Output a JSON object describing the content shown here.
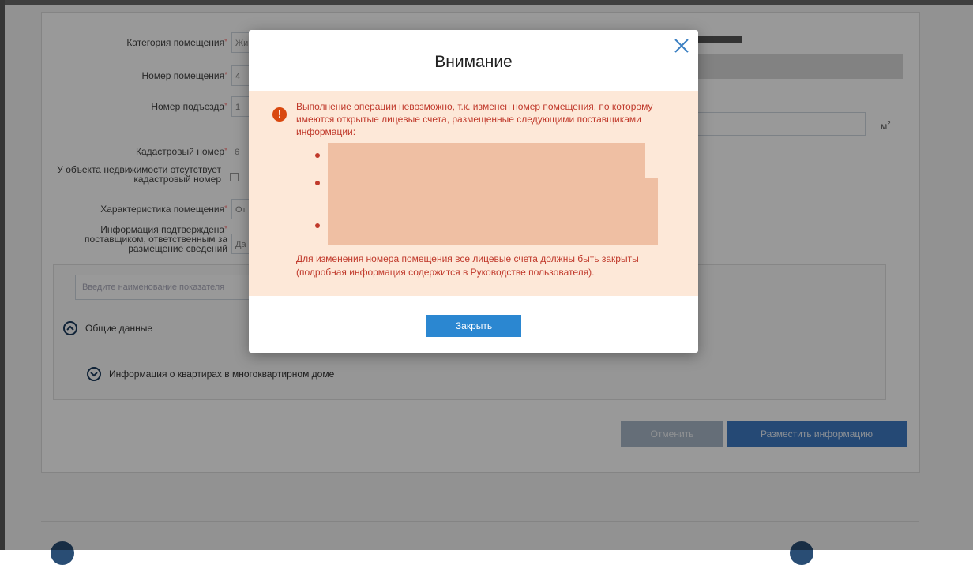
{
  "form": {
    "labels": {
      "category": "Категория помещения",
      "room_number": "Номер помещения",
      "entrance_number": "Номер подъезда",
      "cadastral_number": "Кадастровый номер",
      "no_cadastral_line1": "У объекта недвижимости отсутствует",
      "no_cadastral_line2": "кадастровый номер",
      "characteristic": "Характеристика помещения",
      "confirmed_line1": "Информация подтверждена",
      "confirmed_line2": "поставщиком, ответственным за",
      "confirmed_line3": "размещение сведений"
    },
    "required_mark": "*",
    "values": {
      "category": "Жи",
      "room_number": "4",
      "entrance_number": "1",
      "cadastral_number": "6",
      "characteristic": "От",
      "confirmed": "Да"
    },
    "area_unit": "м",
    "area_unit_sup": "2",
    "search_placeholder": "Введите наименование показателя",
    "section_general": "Общие данные",
    "section_apartments": "Информация о квартирах в многоквартирном доме",
    "cancel_label": "Отменить",
    "submit_label": "Разместить информацию"
  },
  "modal": {
    "title": "Внимание",
    "close_icon": "close-icon",
    "alert_icon": "exclamation-icon",
    "message": "Выполнение операции невозможно, т.к. изменен номер помещения, по которому имеются открытые лицевые счета, размещенные следующими поставщиками информации:",
    "footer_message": "Для изменения номера помещения все лицевые счета должны быть закрыты (подробная информация содержится в Руководстве пользователя).",
    "close_button_label": "Закрыть"
  },
  "colors": {
    "alert_background": "#fde8d8",
    "alert_text": "#c0392b",
    "primary_button": "#2b87d1",
    "submit_button": "#3f7bc4"
  }
}
